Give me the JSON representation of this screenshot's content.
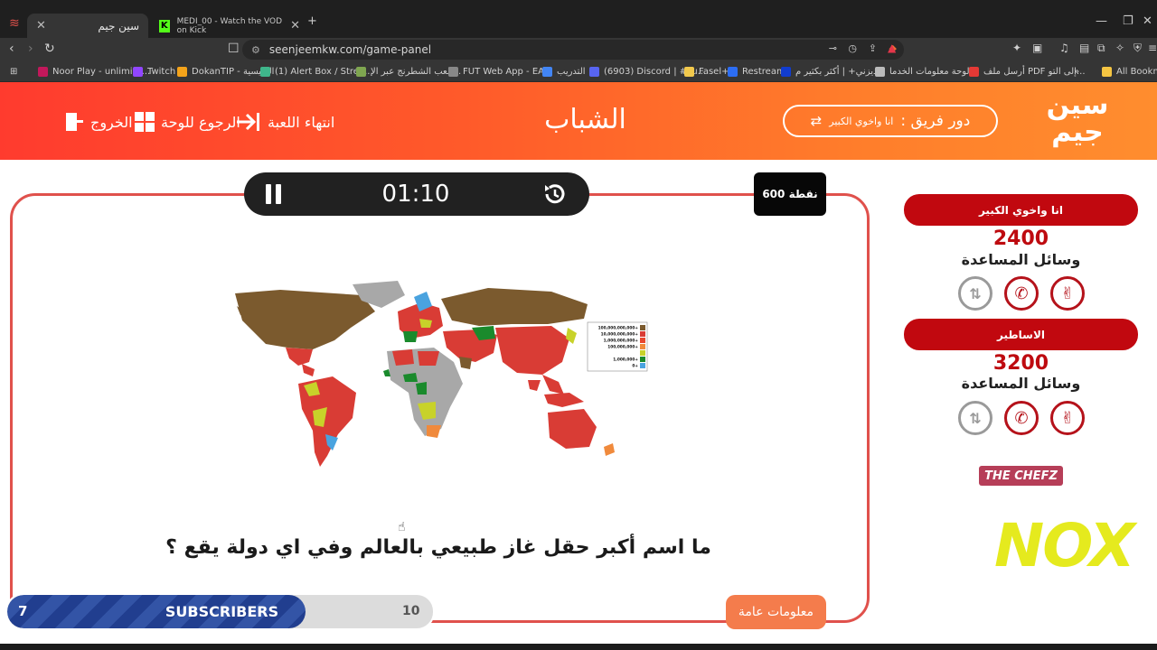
{
  "browser": {
    "tabs": [
      {
        "title": "سين جيم",
        "active": true
      },
      {
        "title": "MEDI_00 - Watch the VOD on Kick",
        "active": false
      }
    ],
    "new_tab": "+",
    "url": "seenjeemkw.com/game-panel",
    "bookmarks": [
      "Noor Play - unlimite...",
      "Twitch",
      "DokanTIP - الرئيسية",
      "(1) Alert Box / Strea...",
      "إلعب الشطرنج عبر الإ...",
      "FUT Web App - EA...",
      "التدريب",
      "(6903) Discord | #su...",
      "Fasel+",
      "Restream",
      "ديزني+ | أكثر بكثير م...",
      "لوحة معلومات الخدما...",
      "أرسل ملف PDF إلى التو...",
      "All Bookmarks"
    ],
    "more_bookmarks": "»"
  },
  "header": {
    "exit": "الخروج",
    "back_to_board": "الرجوع للوحة",
    "end_game": "انتهاء اللعبة",
    "category": "الشباب",
    "turn_label": "دور فريق :",
    "turn_team": "انا واخوي الكبير",
    "logo_line1": "سين",
    "logo_line2": "جيم"
  },
  "question": {
    "timer": "01:10",
    "points": "600 نقطة",
    "text": "ما اسم أكبر حقل غاز طبيعي بالعالم وفي اي دولة يقع ؟",
    "category_badge": "معلومات عامة",
    "legend": [
      "100,000,000,000+",
      "10,000,000,000+",
      "1,000,000,000+",
      "100,000,000+",
      "1,000,000+",
      "0+"
    ],
    "legend_colors": [
      "#7b5a2e",
      "#d93c35",
      "#e8472f",
      "#f08a3c",
      "#c8d22a",
      "#1a8a2c",
      "#4aa3df"
    ]
  },
  "teams": [
    {
      "name": "انا واخوي الكبير",
      "score": "2400",
      "helpers_label": "وسائل المساعدة"
    },
    {
      "name": "الاساطير",
      "score": "3200",
      "helpers_label": "وسائل المساعدة"
    }
  ],
  "sponsors": {
    "chefz": "THE CHEFZ",
    "nox": "NOX"
  },
  "subscribers": {
    "current": "7",
    "title": "SUBSCRIBERS",
    "goal": "10",
    "progress": 0.7
  },
  "colors": {
    "header_start": "#ff3b2e",
    "header_end": "#ff8d2e",
    "team_red": "#c1080f",
    "frame": "#e0514c"
  }
}
